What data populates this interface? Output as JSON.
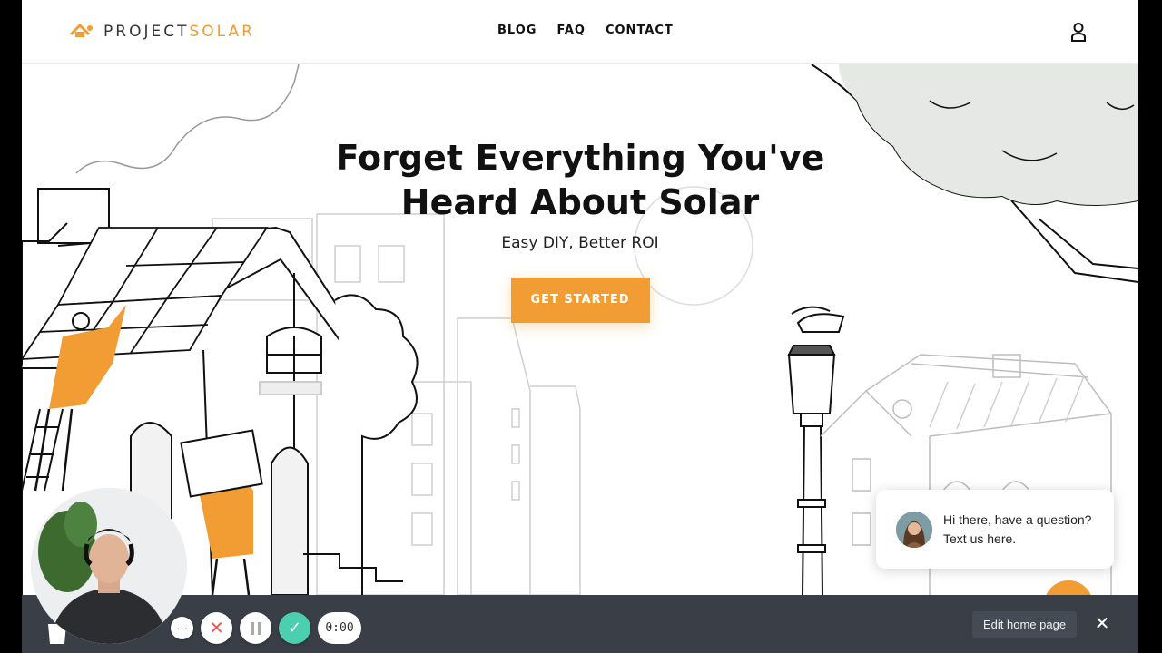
{
  "brand": {
    "logo_prefix": "PROJECT",
    "logo_accent": "SOLAR",
    "accent_color": "#f29d33"
  },
  "nav": [
    {
      "label": "BLOG"
    },
    {
      "label": "FAQ"
    },
    {
      "label": "CONTACT"
    }
  ],
  "icons": {
    "account": "user-icon",
    "chat": "chat-bubble-icon",
    "close": "close-icon",
    "pause": "pause-icon",
    "check": "check-icon",
    "cancel": "x-icon",
    "more": "more-dots-icon"
  },
  "hero": {
    "title": "Forget Everything You've Heard About Solar",
    "subtitle": "Easy DIY, Better ROI",
    "cta_label": "GET STARTED"
  },
  "chat": {
    "message": "Hi there, have a question? Text us here."
  },
  "editor": {
    "edit_label": "Edit home page",
    "close_symbol": "✕"
  },
  "recorder": {
    "timer": "0:00",
    "more_symbol": "···",
    "cancel_symbol": "✕",
    "confirm_symbol": "✓",
    "confirm_color": "#4ccfb0"
  }
}
